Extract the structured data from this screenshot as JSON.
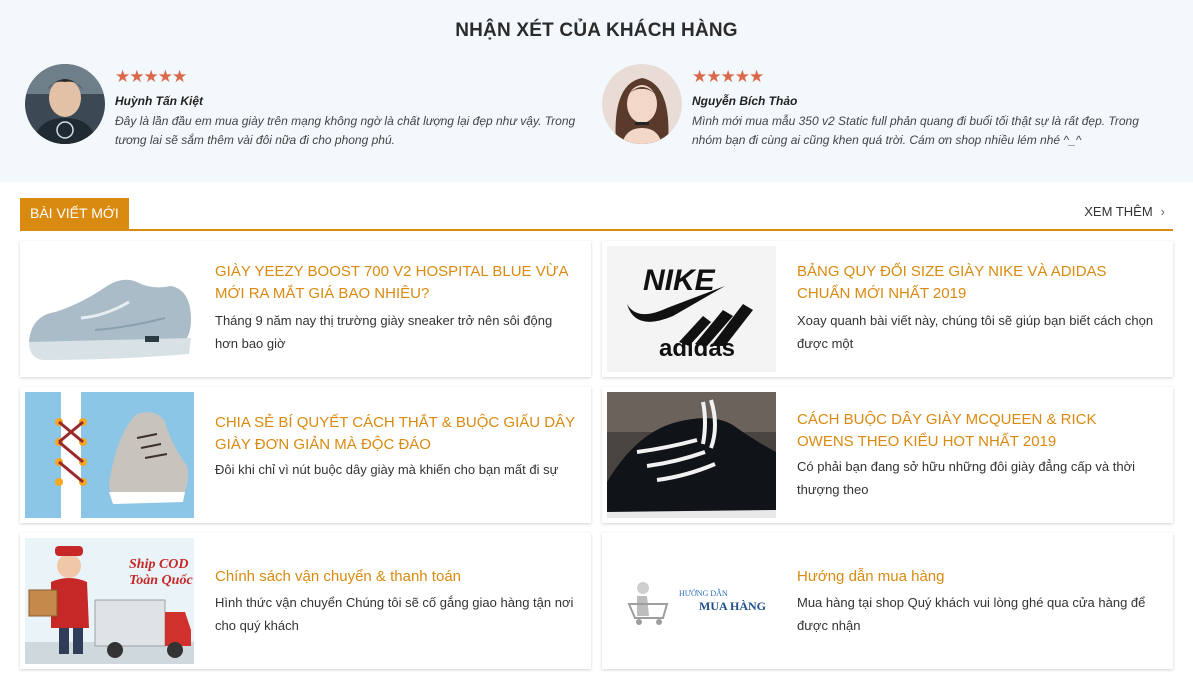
{
  "reviews": {
    "title": "NHẬN XÉT CỦA KHÁCH HÀNG",
    "stars": "★★★★★",
    "items": [
      {
        "name": "Huỳnh Tấn Kiệt",
        "text": "Đây là lần đầu em mua giày trên mạng không ngờ là chất lượng lại đẹp như vậy. Trong tương lai sẽ sắm thêm vài đôi nữa đi cho phong phú."
      },
      {
        "name": "Nguyễn Bích Thảo",
        "text": "Mình mới mua mẫu 350 v2 Static full phản quang đi buổi tối thật sự là rất đẹp. Trong nhóm bạn đi cùng ai cũng khen quá trời. Cám ơn shop nhiều lém nhé ^_^"
      }
    ]
  },
  "posts": {
    "section_label": "BÀI VIẾT MỚI",
    "see_more": "XEM THÊM",
    "items": [
      {
        "title": "GIÀY YEEZY BOOST 700 V2 HOSPITAL BLUE VỪA MỚI RA MẮT GIÁ BAO NHIÊU?",
        "excerpt": "Tháng 9 năm nay thị trường giày sneaker trở nên sôi động hơn bao giờ"
      },
      {
        "title": "BẢNG QUY ĐỔI SIZE GIÀY NIKE VÀ ADIDAS CHUẨN MỚI NHẤT 2019",
        "excerpt": "Xoay quanh bài viết này, chúng tôi sẽ giúp bạn biết cách chọn được một",
        "thumb_text_1": "NIKE",
        "thumb_text_2": "adidas"
      },
      {
        "title": "CHIA SẺ BÍ QUYẾT CÁCH THẮT & BUỘC GIẤU DÂY GIÀY ĐƠN GIẢN MÀ ĐỘC ĐÁO",
        "excerpt": "Đôi khi chỉ vì nút buộc dây giày mà khiến cho bạn mất đi sự"
      },
      {
        "title": "CÁCH BUỘC DÂY GIÀY MCQUEEN & RICK OWENS THEO KIỂU HOT NHẤT 2019",
        "excerpt": "Có phải bạn đang sở hữu những đôi giày đẳng cấp và thời thượng theo"
      },
      {
        "title": "Chính sách vận chuyển & thanh toán",
        "excerpt": "Hình thức vận chuyển Chúng tôi sẽ cố gắng giao hàng tận nơi cho quý khách",
        "thumb_text_1": "Ship COD",
        "thumb_text_2": "Toàn Quốc"
      },
      {
        "title": "Hướng dẫn mua hàng",
        "excerpt": "Mua hàng tại shop Quý khách vui lòng ghé qua cửa hàng để được nhận",
        "thumb_text_1": "HƯỚNG DẪN",
        "thumb_text_2": "MUA HÀNG"
      }
    ]
  },
  "colors": {
    "accent": "#d98a10",
    "stars": "#d9694a",
    "reviews_bg": "#f3f8fc"
  }
}
